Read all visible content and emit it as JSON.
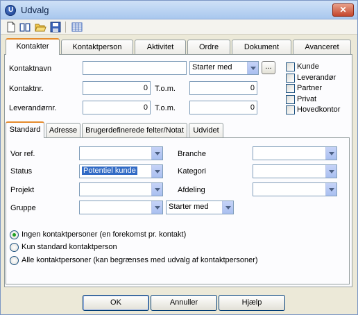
{
  "window": {
    "title": "Udvalg",
    "close_label": "✕"
  },
  "toolbar": {
    "icons": [
      "new-icon",
      "open-book-icon",
      "folder-open-icon",
      "save-icon",
      "table-icon"
    ]
  },
  "main_tabs": [
    "Kontakter",
    "Kontaktperson",
    "Aktivitet",
    "Ordre",
    "Dokument",
    "Avanceret"
  ],
  "contact": {
    "name_label": "Kontaktnavn",
    "name_value": "",
    "match_value": "Starter med",
    "browse_label": "...",
    "nr_label": "Kontaktnr.",
    "nr_from": "0",
    "nr_tom_label": "T.o.m.",
    "nr_to": "0",
    "supplier_label": "Leverandørnr.",
    "supplier_from": "0",
    "supplier_tom_label": "T.o.m.",
    "supplier_to": "0"
  },
  "types": [
    "Kunde",
    "Leverandør",
    "Partner",
    "Privat",
    "Hovedkontor"
  ],
  "sub_tabs": [
    "Standard",
    "Adresse",
    "Brugerdefinerede felter/Notat",
    "Udvidet"
  ],
  "standard": {
    "vor_ref_label": "Vor ref.",
    "vor_ref_value": "",
    "branche_label": "Branche",
    "branche_value": "",
    "status_label": "Status",
    "status_value": "Potentiel kunde",
    "kategori_label": "Kategori",
    "kategori_value": "",
    "projekt_label": "Projekt",
    "projekt_value": "",
    "afdeling_label": "Afdeling",
    "afdeling_value": "",
    "gruppe_label": "Gruppe",
    "gruppe_value": "",
    "gruppe_match": "Starter med"
  },
  "radios": [
    {
      "label": "Ingen kontaktpersoner (en forekomst pr. kontakt)",
      "checked": true
    },
    {
      "label": "Kun standard kontaktperson",
      "checked": false
    },
    {
      "label": "Alle kontaktpersoner (kan begrænses med udvalg af kontaktpersoner)",
      "checked": false
    }
  ],
  "buttons": {
    "ok": "OK",
    "cancel": "Annuller",
    "help": "Hjælp"
  }
}
